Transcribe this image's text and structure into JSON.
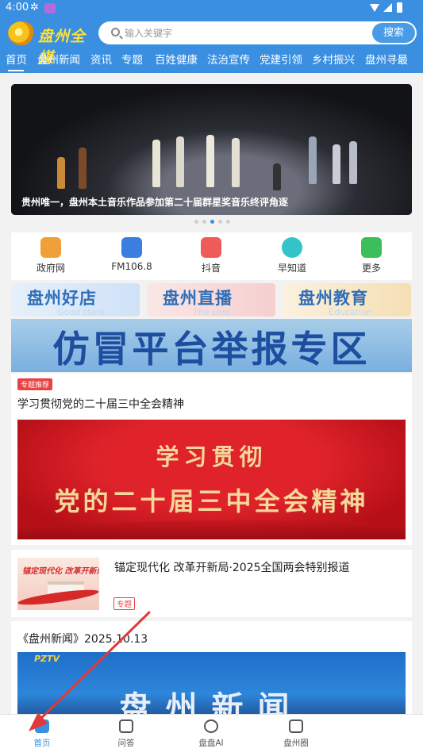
{
  "status_bar": {
    "time": "4:00"
  },
  "app": {
    "logo_text": "盘州全媒"
  },
  "search": {
    "placeholder": "输入关键字",
    "button_label": "搜索"
  },
  "nav": {
    "tabs": [
      "首页",
      "盘州新闻",
      "资讯",
      "专题",
      "百姓健康",
      "法治宣传",
      "党建引领",
      "乡村振兴",
      "盘州寻最"
    ],
    "active_index": 0
  },
  "carousel": {
    "caption": "贵州唯一，盘州本土音乐作品参加第二十届群星奖音乐终评角逐",
    "dot_count": 5,
    "active_dot": 3
  },
  "quick_links": [
    {
      "label": "政府网",
      "icon": "globe-icon",
      "color": "#f0a03a"
    },
    {
      "label": "FM106.8",
      "icon": "radio-icon",
      "color": "#3a7ee0"
    },
    {
      "label": "抖音",
      "icon": "douyin-icon",
      "color": "#ef5b5b"
    },
    {
      "label": "早知道",
      "icon": "home-icon",
      "color": "#34c3c9"
    },
    {
      "label": "更多",
      "icon": "more-icon",
      "color": "#3cbf5a"
    }
  ],
  "promos": [
    {
      "title": "盘州好店",
      "subtitle": "Good store"
    },
    {
      "title": "盘州直播",
      "subtitle": "The Live"
    },
    {
      "title": "盘州教育",
      "subtitle": "Education"
    }
  ],
  "fake_banner": {
    "text": "仿冒平台举报专区"
  },
  "feature_card": {
    "badge": "专题推荐",
    "title": "学习贯彻党的二十届三中全会精神",
    "banner_line1": "学习贯彻",
    "banner_line2": "党的二十届三中全会精神"
  },
  "special_card": {
    "title": "锚定现代化 改革开新局·2025全国两会特别报道",
    "tag": "专题",
    "thumb_text": "锚定现代化 改革开新局"
  },
  "news_card": {
    "title": "《盘州新闻》2025.10.13",
    "thumb_logo": "PZTV",
    "thumb_text": "盘州新闻"
  },
  "bottom_nav": {
    "items": [
      {
        "label": "首页",
        "icon": "home-icon"
      },
      {
        "label": "问答",
        "icon": "chat-icon"
      },
      {
        "label": "盘盘AI",
        "icon": "ai-icon"
      },
      {
        "label": "盘州圈",
        "icon": "circle-icon"
      }
    ],
    "active_index": 0
  },
  "colors": {
    "brand_blue": "#3a8fe0",
    "accent_red": "#e94242",
    "annotation_arrow": "#e03a3a"
  }
}
